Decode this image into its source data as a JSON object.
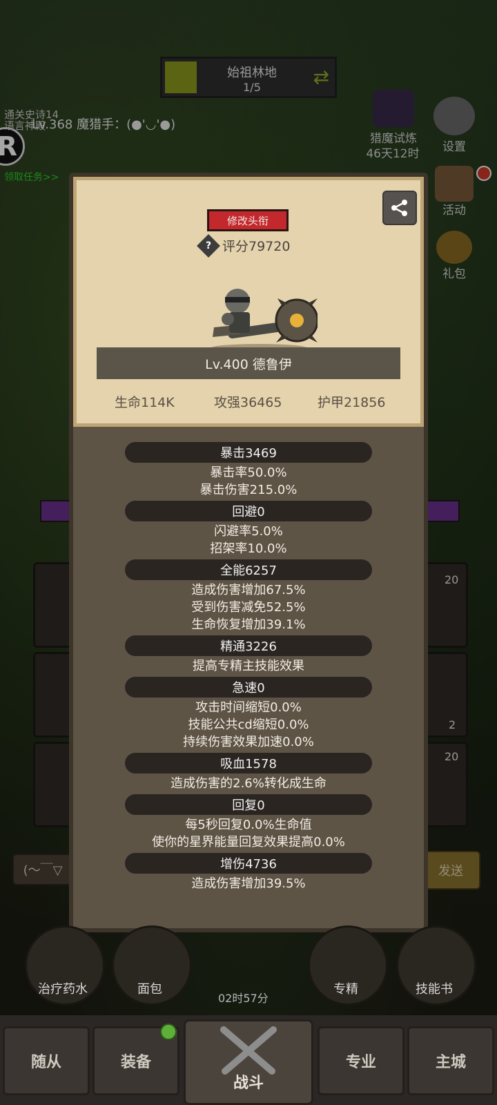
{
  "top": {
    "stage_name": "始祖林地",
    "stage_progress": "1/5",
    "quest_text": "通关史诗14\n语言神殿",
    "player_line": "Lv.368 魔猎手：(●'◡'●)",
    "quest_link": "领取任务>>",
    "badge": "R"
  },
  "side": {
    "event_title": "猎魔试炼",
    "event_time": "46天12时",
    "settings": "设置",
    "activity": "活动",
    "gift": "礼包"
  },
  "card": {
    "title_button": "修改头衔",
    "score": "评分79720",
    "hero_name": "Lv.400 德鲁伊",
    "hp": "生命114K",
    "attack": "攻强36465",
    "armor": "护甲21856"
  },
  "sections": [
    {
      "header": "暴击3469",
      "lines": [
        "暴击率50.0%",
        "暴击伤害215.0%"
      ]
    },
    {
      "header": "回避0",
      "lines": [
        "闪避率5.0%",
        "招架率10.0%"
      ]
    },
    {
      "header": "全能6257",
      "lines": [
        "造成伤害增加67.5%",
        "受到伤害减免52.5%",
        "生命恢复增加39.1%"
      ]
    },
    {
      "header": "精通3226",
      "lines": [
        "提高专精主技能效果"
      ]
    },
    {
      "header": "急速0",
      "lines": [
        "攻击时间缩短0.0%",
        "技能公共cd缩短0.0%",
        "持续伤害效果加速0.0%"
      ]
    },
    {
      "header": "吸血1578",
      "lines": [
        "造成伤害的2.6%转化成生命"
      ]
    },
    {
      "header": "回复0",
      "lines": [
        "每5秒回复0.0%生命值",
        "使你的星界能量回复效果提高0.0%"
      ]
    },
    {
      "header": "增伤4736",
      "lines": [
        "造成伤害增加39.5%"
      ]
    }
  ],
  "background": {
    "chat_placeholder": "(～￣▽",
    "send": "发送",
    "slot_counts": [
      "20",
      "2",
      "20"
    ]
  },
  "skills": {
    "potion": "治疗药水",
    "bread": "面包",
    "spec": "专精",
    "skillbook": "技能书",
    "timer": "02时57分"
  },
  "nav": {
    "followers": "随从",
    "equipment": "装备",
    "battle": "战斗",
    "profession": "专业",
    "city": "主城"
  }
}
